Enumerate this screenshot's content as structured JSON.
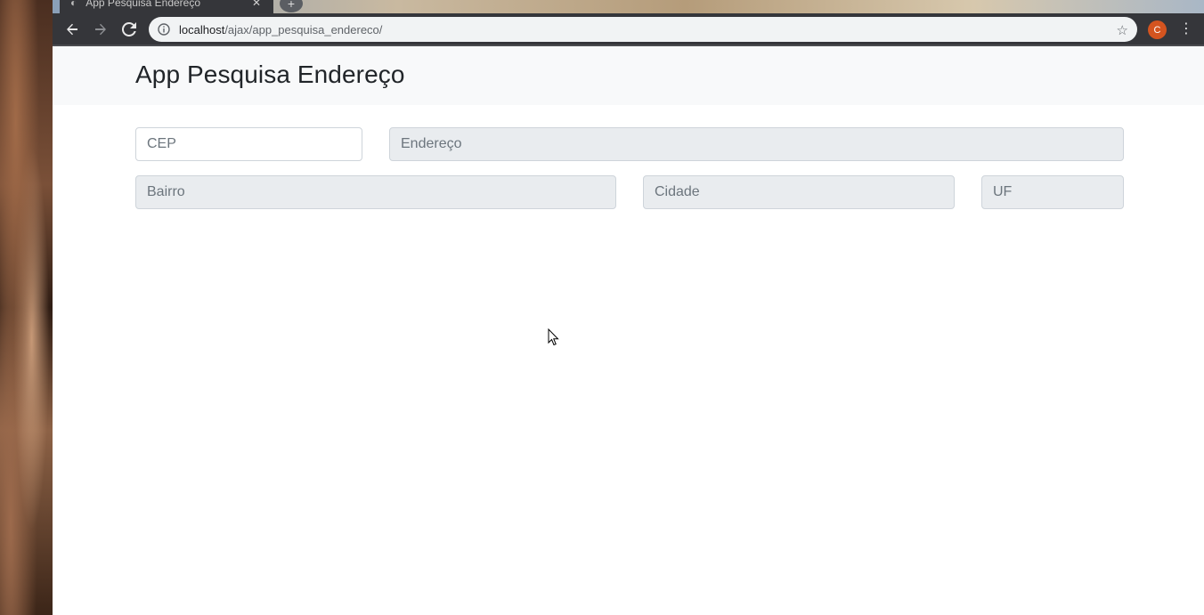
{
  "browser": {
    "tab_title": "App Pesquisa Endereço",
    "tab_close": "✕",
    "new_tab": "+",
    "url_host": "localhost",
    "url_path": "/ajax/app_pesquisa_endereco/",
    "profile_initial": "C",
    "icons": {
      "back": "arrow-left-icon",
      "forward": "arrow-right-icon",
      "reload": "reload-icon",
      "info": "info-icon",
      "bookmark": "star-icon",
      "menu": "kebab-menu-icon"
    }
  },
  "page": {
    "title": "App Pesquisa Endereço",
    "fields": {
      "cep": {
        "placeholder": "CEP",
        "value": ""
      },
      "endereco": {
        "placeholder": "Endereço",
        "value": ""
      },
      "bairro": {
        "placeholder": "Bairro",
        "value": ""
      },
      "cidade": {
        "placeholder": "Cidade",
        "value": ""
      },
      "uf": {
        "placeholder": "UF",
        "value": ""
      }
    }
  },
  "colors": {
    "header_bg": "#f8f9fa",
    "readonly_bg": "#e9ecef",
    "input_border": "#ced4da",
    "avatar_bg": "#d4541f"
  }
}
